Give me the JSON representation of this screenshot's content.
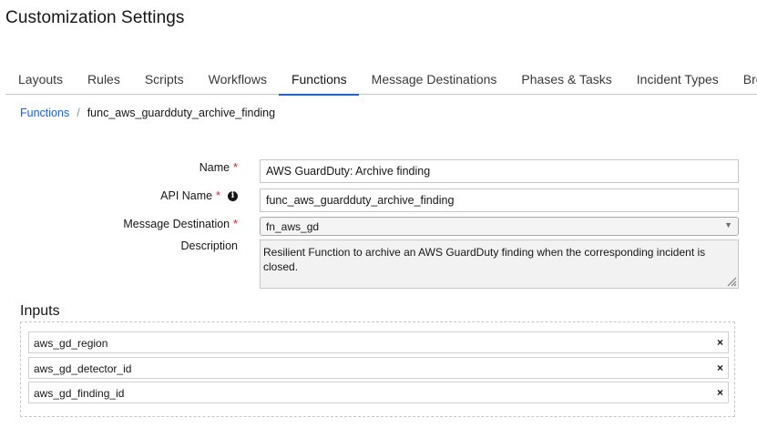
{
  "page": {
    "title": "Customization Settings"
  },
  "tabs": [
    {
      "label": "Layouts",
      "active": false
    },
    {
      "label": "Rules",
      "active": false
    },
    {
      "label": "Scripts",
      "active": false
    },
    {
      "label": "Workflows",
      "active": false
    },
    {
      "label": "Functions",
      "active": true
    },
    {
      "label": "Message Destinations",
      "active": false
    },
    {
      "label": "Phases & Tasks",
      "active": false
    },
    {
      "label": "Incident Types",
      "active": false
    },
    {
      "label": "Breach",
      "active": false
    }
  ],
  "breadcrumb": {
    "parent": "Functions",
    "separator": "/",
    "current": "func_aws_guardduty_archive_finding"
  },
  "form": {
    "name": {
      "label": "Name",
      "required_mark": "*",
      "value": "AWS GuardDuty: Archive finding"
    },
    "api_name": {
      "label": "API Name",
      "required_mark": "*",
      "info_icon": "info-icon",
      "value": "func_aws_guardduty_archive_finding"
    },
    "message_destination": {
      "label": "Message Destination",
      "required_mark": "*",
      "value": "fn_aws_gd",
      "arrow": "▼"
    },
    "description": {
      "label": "Description",
      "value": "Resilient Function to archive an AWS GuardDuty finding when the corresponding incident is closed."
    }
  },
  "inputs": {
    "title": "Inputs",
    "remove_glyph": "×",
    "items": [
      {
        "label": "aws_gd_region"
      },
      {
        "label": "aws_gd_detector_id"
      },
      {
        "label": "aws_gd_finding_id"
      }
    ]
  },
  "colors": {
    "accent": "#0f62fe",
    "required": "#da1e28",
    "text": "#161616"
  }
}
